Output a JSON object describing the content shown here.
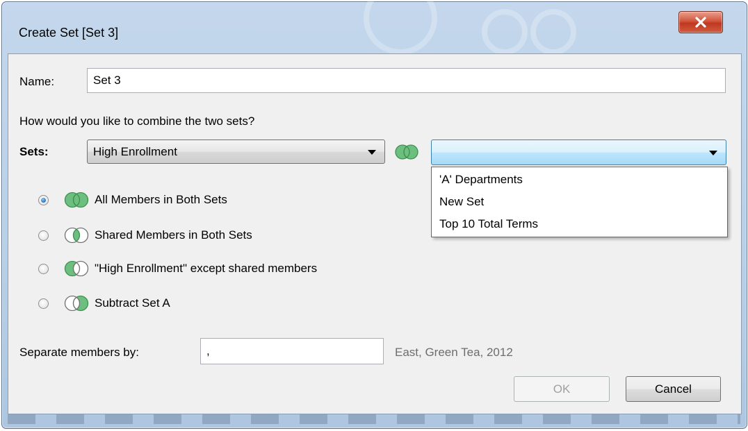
{
  "window": {
    "title": "Create Set [Set 3]"
  },
  "form": {
    "name_label": "Name:",
    "name_value": "Set 3",
    "question": "How would you like to combine the two sets?",
    "sets_label": "Sets:",
    "set_a_selected": "High Enrollment",
    "set_b_selected": "",
    "set_b_options": [
      "'A' Departments",
      "New Set",
      "Top 10 Total Terms"
    ],
    "combine_options": [
      {
        "label": "All Members in Both Sets",
        "checked": true,
        "icon": "venn-union-icon"
      },
      {
        "label": "Shared Members in Both Sets",
        "checked": false,
        "icon": "venn-intersect-icon"
      },
      {
        "label": "\"High Enrollment\" except shared members",
        "checked": false,
        "icon": "venn-left-only-icon"
      },
      {
        "label": "Subtract Set A",
        "checked": false,
        "icon": "venn-right-only-icon"
      }
    ],
    "separator_label": "Separate members by:",
    "separator_value": ",",
    "separator_example": "East, Green Tea, 2012"
  },
  "buttons": {
    "ok": "OK",
    "cancel": "Cancel"
  },
  "colors": {
    "venn_green": "#6cbf7e",
    "venn_outline": "#3f8f50",
    "close_red": "#c0381f"
  }
}
